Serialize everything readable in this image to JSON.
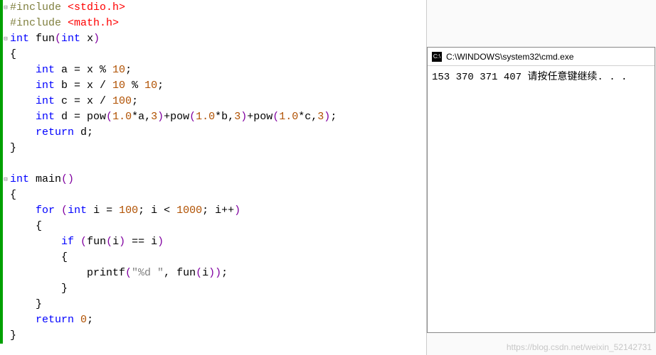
{
  "code": {
    "lines": [
      {
        "fold": "-",
        "tokens": [
          [
            "pre",
            "#include "
          ],
          [
            "inc",
            "<stdio.h>"
          ]
        ]
      },
      {
        "fold": "",
        "tokens": [
          [
            "pre",
            "#include "
          ],
          [
            "inc",
            "<math.h>"
          ]
        ]
      },
      {
        "fold": "-",
        "tokens": [
          [
            "kw",
            "int"
          ],
          [
            "",
            " fun"
          ],
          [
            "paren",
            "("
          ],
          [
            "kw",
            "int"
          ],
          [
            "",
            " x"
          ],
          [
            "paren",
            ")"
          ]
        ]
      },
      {
        "fold": "",
        "tokens": [
          [
            "brace",
            "{"
          ]
        ]
      },
      {
        "fold": "",
        "tokens": [
          [
            "",
            "    "
          ],
          [
            "kw",
            "int"
          ],
          [
            "",
            " a = x % "
          ],
          [
            "num",
            "10"
          ],
          [
            "",
            ";"
          ]
        ]
      },
      {
        "fold": "",
        "tokens": [
          [
            "",
            "    "
          ],
          [
            "kw",
            "int"
          ],
          [
            "",
            " b = x / "
          ],
          [
            "num",
            "10"
          ],
          [
            "",
            " % "
          ],
          [
            "num",
            "10"
          ],
          [
            "",
            ";"
          ]
        ]
      },
      {
        "fold": "",
        "tokens": [
          [
            "",
            "    "
          ],
          [
            "kw",
            "int"
          ],
          [
            "",
            " c = x / "
          ],
          [
            "num",
            "100"
          ],
          [
            "",
            ";"
          ]
        ]
      },
      {
        "fold": "",
        "tokens": [
          [
            "",
            "    "
          ],
          [
            "kw",
            "int"
          ],
          [
            "",
            " d = pow"
          ],
          [
            "paren",
            "("
          ],
          [
            "num",
            "1.0"
          ],
          [
            "",
            "*a,"
          ],
          [
            "num",
            "3"
          ],
          [
            "paren",
            ")"
          ],
          [
            "",
            "+pow"
          ],
          [
            "paren",
            "("
          ],
          [
            "num",
            "1.0"
          ],
          [
            "",
            "*b,"
          ],
          [
            "num",
            "3"
          ],
          [
            "paren",
            ")"
          ],
          [
            "",
            "+pow"
          ],
          [
            "paren",
            "("
          ],
          [
            "num",
            "1.0"
          ],
          [
            "",
            "*c,"
          ],
          [
            "num",
            "3"
          ],
          [
            "paren",
            ")"
          ],
          [
            "",
            ";"
          ]
        ]
      },
      {
        "fold": "",
        "tokens": [
          [
            "",
            "    "
          ],
          [
            "kw",
            "return"
          ],
          [
            "",
            " d;"
          ]
        ]
      },
      {
        "fold": "",
        "tokens": [
          [
            "brace",
            "}"
          ]
        ]
      },
      {
        "fold": "",
        "tokens": [
          [
            "",
            ""
          ]
        ]
      },
      {
        "fold": "-",
        "tokens": [
          [
            "kw",
            "int"
          ],
          [
            "",
            " main"
          ],
          [
            "paren",
            "()"
          ]
        ]
      },
      {
        "fold": "",
        "tokens": [
          [
            "brace",
            "{"
          ]
        ]
      },
      {
        "fold": "",
        "tokens": [
          [
            "",
            "    "
          ],
          [
            "kw",
            "for"
          ],
          [
            "",
            " "
          ],
          [
            "paren",
            "("
          ],
          [
            "kw",
            "int"
          ],
          [
            "",
            " i = "
          ],
          [
            "num",
            "100"
          ],
          [
            "",
            "; i < "
          ],
          [
            "num",
            "1000"
          ],
          [
            "",
            "; i++"
          ],
          [
            "paren",
            ")"
          ]
        ]
      },
      {
        "fold": "",
        "tokens": [
          [
            "",
            "    "
          ],
          [
            "brace",
            "{"
          ]
        ]
      },
      {
        "fold": "",
        "tokens": [
          [
            "",
            "        "
          ],
          [
            "kw",
            "if"
          ],
          [
            "",
            " "
          ],
          [
            "paren",
            "("
          ],
          [
            "",
            "fun"
          ],
          [
            "paren",
            "("
          ],
          [
            "",
            "i"
          ],
          [
            "paren",
            ")"
          ],
          [
            "",
            " == i"
          ],
          [
            "paren",
            ")"
          ]
        ]
      },
      {
        "fold": "",
        "tokens": [
          [
            "",
            "        "
          ],
          [
            "brace",
            "{"
          ]
        ]
      },
      {
        "fold": "",
        "tokens": [
          [
            "",
            "            printf"
          ],
          [
            "paren",
            "("
          ],
          [
            "str",
            "\"%d \""
          ],
          [
            "",
            ", fun"
          ],
          [
            "paren",
            "("
          ],
          [
            "",
            "i"
          ],
          [
            "paren",
            "))"
          ],
          [
            "",
            ";"
          ]
        ]
      },
      {
        "fold": "",
        "tokens": [
          [
            "",
            "        "
          ],
          [
            "brace",
            "}"
          ]
        ]
      },
      {
        "fold": "",
        "tokens": [
          [
            "",
            "    "
          ],
          [
            "brace",
            "}"
          ]
        ]
      },
      {
        "fold": "",
        "tokens": [
          [
            "",
            "    "
          ],
          [
            "kw",
            "return"
          ],
          [
            "",
            " "
          ],
          [
            "num",
            "0"
          ],
          [
            "",
            ";"
          ]
        ]
      },
      {
        "fold": "",
        "tokens": [
          [
            "brace",
            "}"
          ]
        ]
      }
    ]
  },
  "cmd": {
    "icon_text": "C:\\",
    "title": "C:\\WINDOWS\\system32\\cmd.exe",
    "output": "153 370 371 407 请按任意键继续. . ."
  },
  "watermark": "https://blog.csdn.net/weixin_52142731"
}
